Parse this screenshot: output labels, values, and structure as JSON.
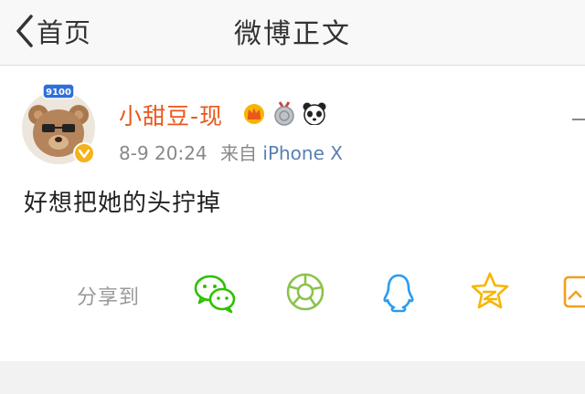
{
  "header": {
    "back_label": "首页",
    "title": "微博正文"
  },
  "post": {
    "username": "小甜豆-现",
    "timestamp": "8-9 20:24",
    "source_prefix": "来自",
    "source": "iPhone X",
    "content": "好想把她的头拧掉",
    "avatar_badge": "9100"
  },
  "share": {
    "label": "分享到",
    "icons": [
      "wechat-icon",
      "moments-icon",
      "qq-icon",
      "qzone-icon",
      "image-icon"
    ]
  },
  "colors": {
    "username": "#e8581c",
    "source": "#5b80b0",
    "wechat": "#2dc100",
    "moments": "#8bc34a",
    "qq": "#2a9bf0",
    "qzone": "#f7b500"
  }
}
